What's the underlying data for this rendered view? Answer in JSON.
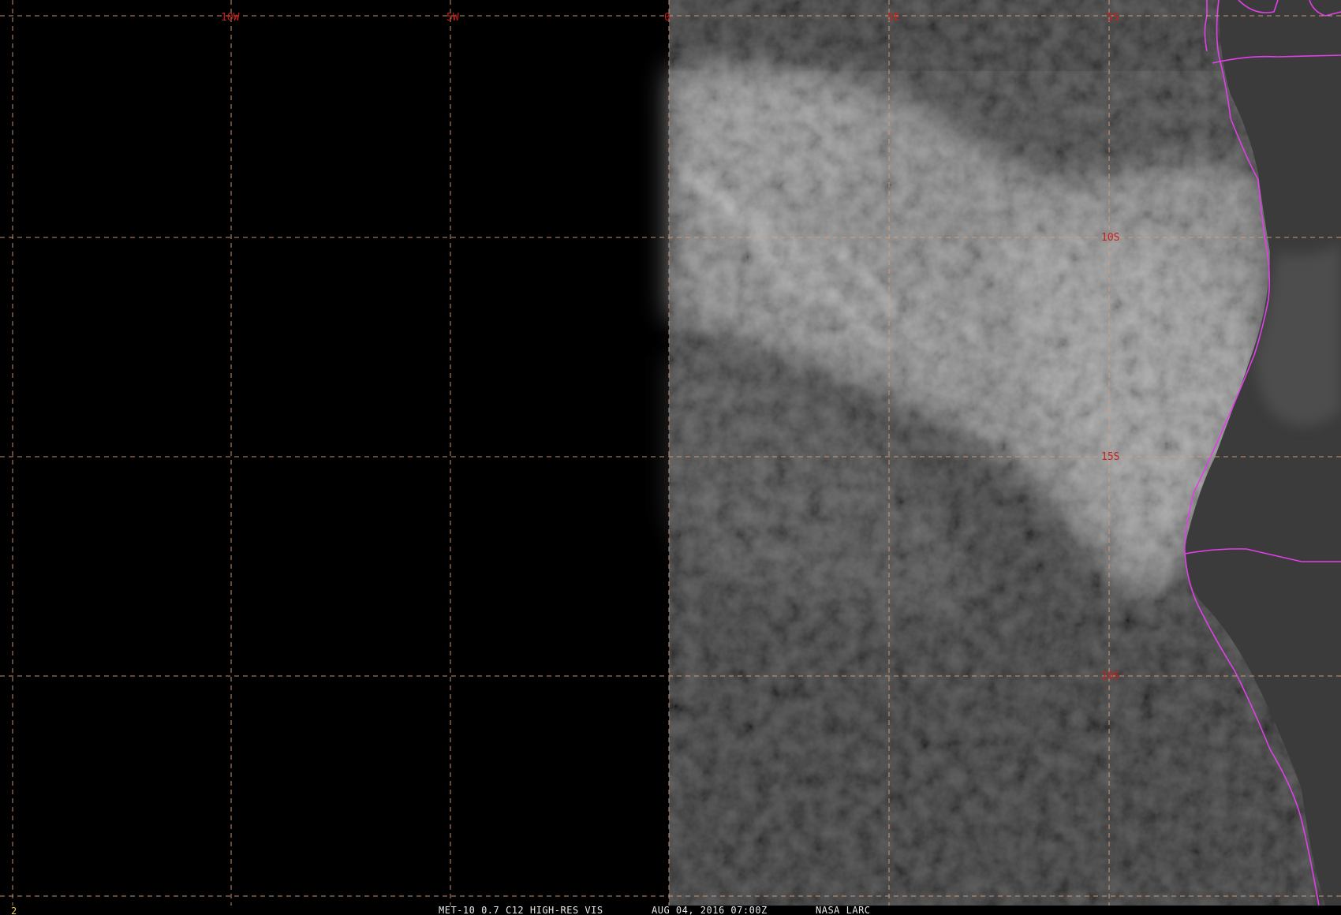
{
  "window": {
    "title": "MET-10 0.7 C12 HIGH-RES VIS"
  },
  "colors": {
    "background": "#000000",
    "grid": "#d9a27a",
    "grid_label": "#c8201c",
    "border": "#e040e8",
    "footer_text": "#e8e8e8",
    "frame_number": "#e0d040"
  },
  "map": {
    "longitude_labels": [
      "10W",
      "5W",
      "0",
      "5E",
      "5S"
    ],
    "latitude_labels": [
      "10S",
      "15S",
      "20S"
    ]
  },
  "footer": {
    "frame_number": "2",
    "product": "MET-10 0.7 C12 HIGH-RES VIS",
    "datetime": "AUG 04, 2016 07:00Z",
    "source": "NASA LARC"
  }
}
